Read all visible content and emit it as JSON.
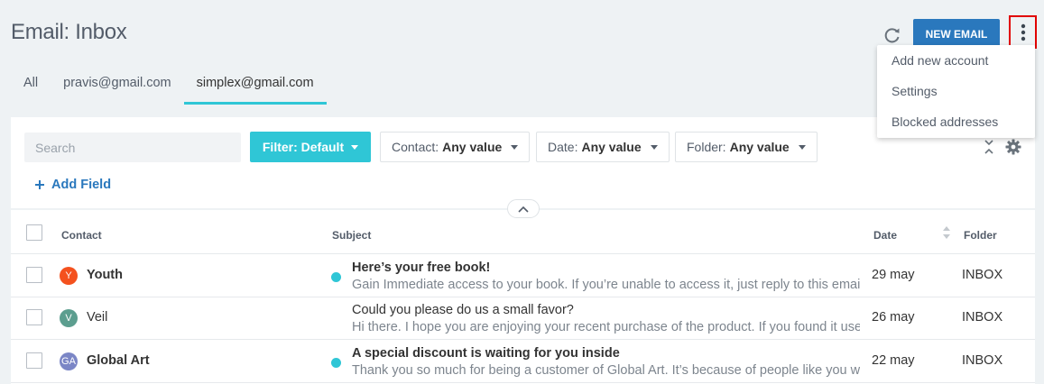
{
  "header": {
    "title": "Email: Inbox",
    "new_email_label": "NEW EMAIL"
  },
  "menu": {
    "items": [
      {
        "label": "Add new account"
      },
      {
        "label": "Settings"
      },
      {
        "label": "Blocked addresses"
      }
    ]
  },
  "tabs": [
    {
      "label": "All",
      "active": false
    },
    {
      "label": "pravis@gmail.com",
      "active": false
    },
    {
      "label": "simplex@gmail.com",
      "active": true
    }
  ],
  "filters": {
    "search_placeholder": "Search",
    "filter_label": "Filter: Default",
    "contact_label": "Contact:",
    "contact_value": "Any value",
    "date_label": "Date:",
    "date_value": "Any value",
    "folder_label": "Folder:",
    "folder_value": "Any value",
    "add_field_label": "Add Field"
  },
  "grid": {
    "columns": {
      "contact": "Contact",
      "subject": "Subject",
      "date": "Date",
      "folder": "Folder"
    },
    "rows": [
      {
        "avatar": "Y",
        "avatar_color": "#f4511e",
        "contact": "Youth",
        "unread": true,
        "subject": "Here’s your free book!",
        "preview": "Gain Immediate access to your book. If you’re unable to access it, just reply to this email",
        "date": "29 may",
        "folder": "INBOX"
      },
      {
        "avatar": "V",
        "avatar_color": "#5c9e8f",
        "contact": "Veil",
        "unread": false,
        "subject": "Could you please do us a small favor?",
        "preview": "Hi there. I hope you are enjoying your recent purchase of the product. If you found it useful",
        "date": "26 may",
        "folder": "INBOX"
      },
      {
        "avatar": "GA",
        "avatar_color": "#7b86c6",
        "contact": "Global Art",
        "unread": true,
        "subject": "A special discount is waiting for you inside",
        "preview": "Thank you so much for being a customer of Global Art. It’s because of people like you we",
        "date": "22 may",
        "folder": "INBOX"
      }
    ]
  },
  "colors": {
    "accent": "#2fc6d6",
    "primary": "#2a78bd",
    "highlight": "#e10000"
  }
}
